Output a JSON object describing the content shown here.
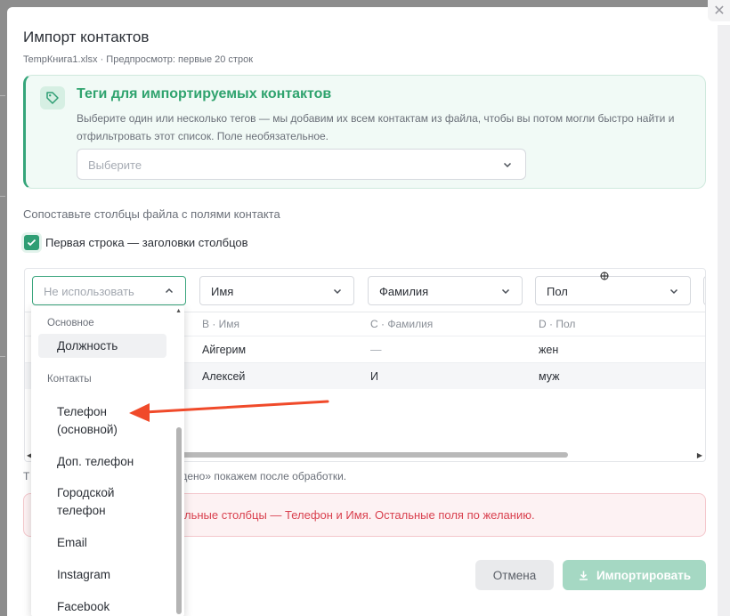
{
  "modal": {
    "title": "Импорт контактов",
    "subtitle": "TempКнига1.xlsx · Предпросмотр: первые 20 строк",
    "close_glyph": "✕"
  },
  "tags": {
    "title": "Теги для импортируемых контактов",
    "description": "Выберите один или несколько тегов — мы добавим их всем контактам из файла, чтобы вы потом могли быстро найти и отфильтровать этот список. Поле необязательное.",
    "select_placeholder": "Выберите"
  },
  "mapping": {
    "title": "Сопоставьте столбцы файла с полями контакта",
    "header_row_label": "Первая строка — заголовки столбцов",
    "header_row_checked": true,
    "column_selects": [
      "Не использовать",
      "Имя",
      "Фамилия",
      "Пол"
    ],
    "column_headers": [
      "B · Имя",
      "C · Фамилия",
      "D · Пол"
    ],
    "rows": [
      [
        "Айгерим",
        "—",
        "жен"
      ],
      [
        "Алексей",
        "И",
        "муж"
      ]
    ]
  },
  "note": {
    "visible_start": "Т",
    "visible_end": "дено» покажем после обработки."
  },
  "error": {
    "text": "льные столбцы — Телефон и Имя. Остальные поля по желанию."
  },
  "buttons": {
    "cancel": "Отмена",
    "import": "Импортировать"
  },
  "dropdown": {
    "group_main": "Основное",
    "item_position": "Должность",
    "group_contacts": "Контакты",
    "item_phone_main_1": "Телефон",
    "item_phone_main_2": "(основной)",
    "item_extra_phone": "Доп. телефон",
    "item_city_phone_1": "Городской",
    "item_city_phone_2": "телефон",
    "item_email": "Email",
    "item_instagram": "Instagram",
    "item_facebook": "Facebook"
  },
  "colors": {
    "accent": "#2f9e74",
    "error": "#d9414f",
    "annotation_arrow": "#f04a2a"
  }
}
